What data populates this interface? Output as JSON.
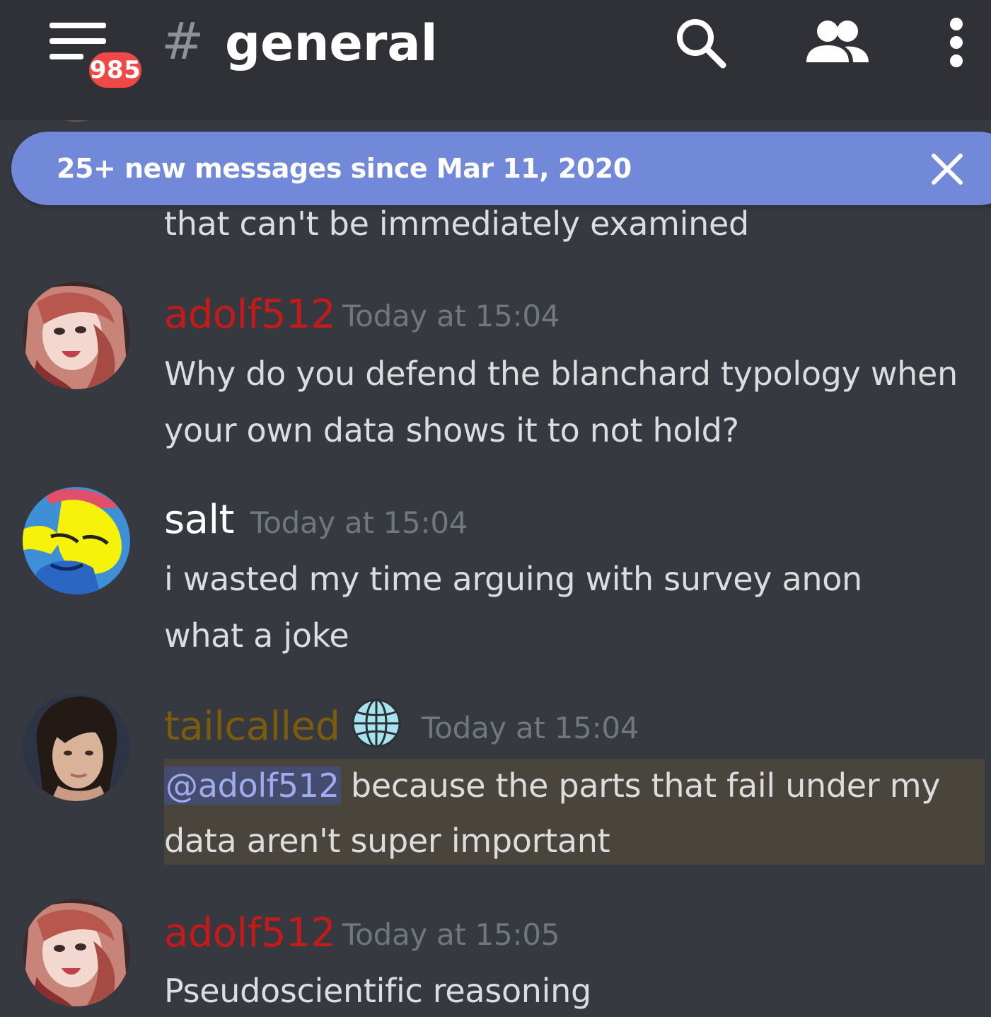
{
  "header": {
    "unread_count": "985",
    "hash_symbol": "#",
    "channel_name": "general"
  },
  "banner": {
    "text": "25+ new messages since Mar 11, 2020"
  },
  "colors": {
    "header_bg": "#2f3136",
    "chat_bg": "#36393f",
    "banner_bg": "#7289da",
    "badge_red": "#f04747",
    "author_adolf512": "#c41a1a",
    "author_tailcalled": "#7a5c0c",
    "author_salt": "#ffffff",
    "mention_highlight": "#49443c",
    "mention_pill": "#464c6e"
  },
  "messages": [
    {
      "continuation_text": "that can't be immediately examined"
    },
    {
      "author": "adolf512",
      "timestamp": "Today at 15:04",
      "lines": [
        "Why do you defend the blanchard typology when",
        "your own data shows it to not hold?"
      ]
    },
    {
      "author": "salt",
      "timestamp": "Today at 15:04",
      "lines": [
        "i wasted my time arguing with survey anon",
        "what a joke"
      ]
    },
    {
      "author": "tailcalled",
      "badge_icon": "globe-icon",
      "timestamp": "Today at 15:04",
      "mention": "@adolf512",
      "lines": [
        " because the parts that fail under my",
        "data aren't super important"
      ]
    },
    {
      "author": "adolf512",
      "timestamp": "Today at 15:05",
      "lines": [
        "Pseudoscientific reasoning"
      ]
    }
  ]
}
